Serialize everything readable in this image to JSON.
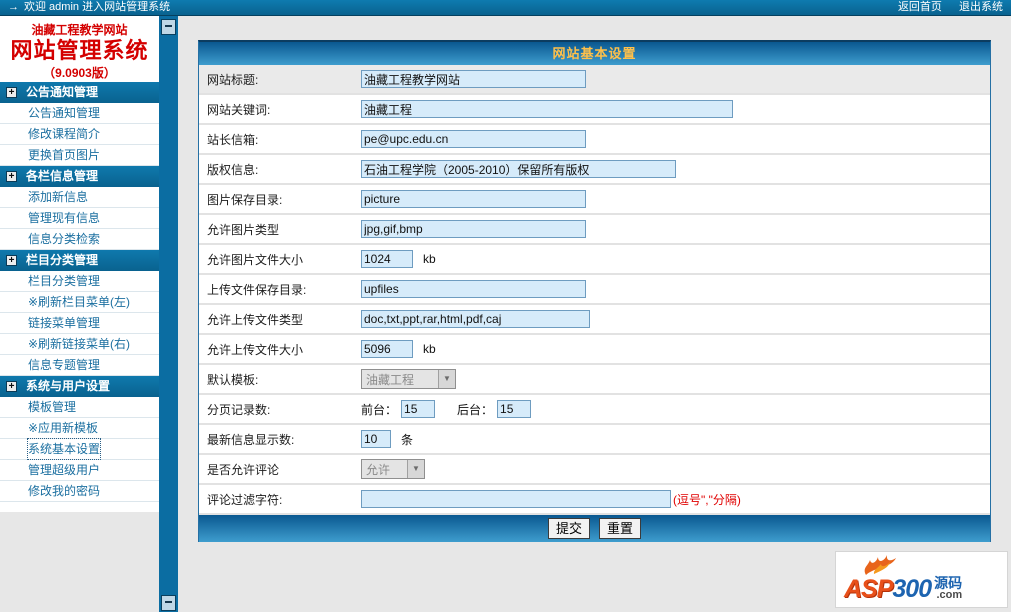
{
  "topbar": {
    "arrow": "→",
    "welcome_text": "欢迎  admin 进入网站管理系统",
    "home_link": "返回首页",
    "logout_link": "退出系统"
  },
  "sidebar": {
    "site_name": "油藏工程教学网站",
    "system_name": "网站管理系统",
    "version": "（9.0903版）",
    "selected_item": "系统基本设置",
    "sections": [
      {
        "title": "公告通知管理",
        "items": [
          {
            "label": "公告通知管理"
          },
          {
            "label": "修改课程简介"
          },
          {
            "label": "更换首页图片"
          }
        ]
      },
      {
        "title": "各栏信息管理",
        "items": [
          {
            "label": "添加新信息"
          },
          {
            "label": "管理现有信息"
          },
          {
            "label": "信息分类检索"
          }
        ]
      },
      {
        "title": "栏目分类管理",
        "items": [
          {
            "label": "栏目分类管理"
          },
          {
            "label": "※刷新栏目菜单(左)"
          },
          {
            "label": "链接菜单管理"
          },
          {
            "label": "※刷新链接菜单(右)"
          },
          {
            "label": "信息专题管理"
          }
        ]
      },
      {
        "title": "系统与用户设置",
        "items": [
          {
            "label": "模板管理"
          },
          {
            "label": "※应用新模板"
          },
          {
            "label": "系统基本设置"
          },
          {
            "label": "管理超级用户"
          },
          {
            "label": "修改我的密码"
          }
        ]
      }
    ]
  },
  "panel": {
    "title": "网站基本设置",
    "fields": {
      "site_title": {
        "label": "网站标题:",
        "value": "油藏工程教学网站"
      },
      "keywords": {
        "label": "网站关键词:",
        "value": "油藏工程"
      },
      "email": {
        "label": "站长信箱:",
        "value": "pe@upc.edu.cn"
      },
      "copyright": {
        "label": "版权信息:",
        "value": "石油工程学院（2005-2010）保留所有版权"
      },
      "image_dir": {
        "label": "图片保存目录:",
        "value": "picture"
      },
      "image_types": {
        "label": "允许图片类型",
        "value": "jpg,gif,bmp"
      },
      "image_size": {
        "label": "允许图片文件大小",
        "value": "1024",
        "suffix": "kb"
      },
      "upload_dir": {
        "label": "上传文件保存目录:",
        "value": "upfiles"
      },
      "upload_types": {
        "label": "允许上传文件类型",
        "value": "doc,txt,ppt,rar,html,pdf,caj"
      },
      "upload_size": {
        "label": "允许上传文件大小",
        "value": "5096",
        "suffix": "kb"
      },
      "template": {
        "label": "默认模板:",
        "value": "油藏工程"
      },
      "paging": {
        "label": "分页记录数:",
        "front_label": "前台：",
        "front_value": "15",
        "back_label": "后台：",
        "back_value": "15"
      },
      "latest_count": {
        "label": "最新信息显示数:",
        "value": "10",
        "suffix": "条"
      },
      "comments": {
        "label": "是否允许评论",
        "value": "允许"
      },
      "comment_filter": {
        "label": "评论过滤字符:",
        "value": "",
        "note": "(逗号\",\"分隔)"
      }
    },
    "buttons": {
      "submit": "提交",
      "reset": "重置"
    }
  },
  "logo": {
    "asp": "ASP",
    "num": "300",
    "cn": "源码",
    "com": ".com"
  },
  "colors": {
    "accent_blue": "#0B6DA2",
    "brand_red": "#D40000",
    "title_gold": "#FFC04A",
    "input_bg": "#D6EBFA",
    "note_red": "#E00000"
  }
}
